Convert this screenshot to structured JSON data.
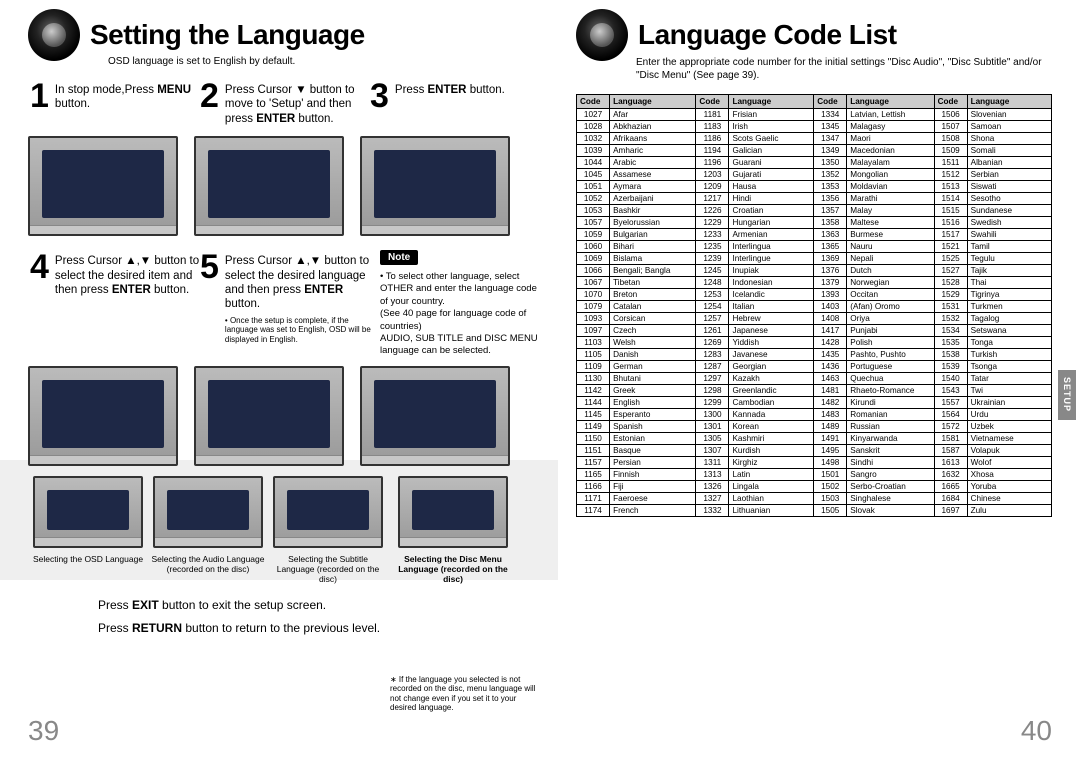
{
  "left": {
    "title": "Setting the Language",
    "subtitle": "OSD language is set to English by default.",
    "steps": [
      {
        "num": "1",
        "html": "In stop mode,Press <b>MENU</b> button."
      },
      {
        "num": "2",
        "html": "Press Cursor ▼ button to move to 'Setup' and then press <b>ENTER</b> button."
      },
      {
        "num": "3",
        "html": "Press <b>ENTER</b> button."
      },
      {
        "num": "4",
        "html": "Press Cursor ▲,▼ button to select the desired item and then press <b>ENTER</b> button."
      },
      {
        "num": "5",
        "html": "Press Cursor ▲,▼ button to select the desired language and then press <b>ENTER</b> button."
      }
    ],
    "step5_footnote": "• Once the setup is complete, if the language was set to English, OSD will be displayed in English.",
    "note_badge": "Note",
    "note_text": "• To select other language, select OTHER and enter the language code of your country.\n(See 40 page for language code of countries)\nAUDIO, SUB TITLE and DISC MENU language can be selected.",
    "captions": [
      "Selecting the OSD Language",
      "Selecting the Audio Language (recorded on the disc)",
      "Selecting the Subtitle Language (recorded on the disc)",
      "Selecting the Disc Menu Language (recorded on the disc)"
    ],
    "exit": "Press EXIT button to exit the setup screen.",
    "return": "Press RETURN button to return to the previous level.",
    "right_small_note": "∗ If the language you selected is not recorded on the disc, menu language will not change even if you set it to your desired language.",
    "page_no": "39"
  },
  "right": {
    "title": "Language Code List",
    "intro": "Enter the appropriate code number for the initial settings \"Disc Audio\", \"Disc Subtitle\" and/or \"Disc Menu\" (See page 39).",
    "headers": [
      "Code",
      "Language",
      "Code",
      "Language",
      "Code",
      "Language",
      "Code",
      "Language"
    ],
    "rows": [
      [
        "1027",
        "Afar",
        "1181",
        "Frisian",
        "1334",
        "Latvian, Lettish",
        "1506",
        "Slovenian"
      ],
      [
        "1028",
        "Abkhazian",
        "1183",
        "Irish",
        "1345",
        "Malagasy",
        "1507",
        "Samoan"
      ],
      [
        "1032",
        "Afrikaans",
        "1186",
        "Scots Gaelic",
        "1347",
        "Maori",
        "1508",
        "Shona"
      ],
      [
        "1039",
        "Amharic",
        "1194",
        "Galician",
        "1349",
        "Macedonian",
        "1509",
        "Somali"
      ],
      [
        "1044",
        "Arabic",
        "1196",
        "Guarani",
        "1350",
        "Malayalam",
        "1511",
        "Albanian"
      ],
      [
        "1045",
        "Assamese",
        "1203",
        "Gujarati",
        "1352",
        "Mongolian",
        "1512",
        "Serbian"
      ],
      [
        "1051",
        "Aymara",
        "1209",
        "Hausa",
        "1353",
        "Moldavian",
        "1513",
        "Siswati"
      ],
      [
        "1052",
        "Azerbaijani",
        "1217",
        "Hindi",
        "1356",
        "Marathi",
        "1514",
        "Sesotho"
      ],
      [
        "1053",
        "Bashkir",
        "1226",
        "Croatian",
        "1357",
        "Malay",
        "1515",
        "Sundanese"
      ],
      [
        "1057",
        "Byelorussian",
        "1229",
        "Hungarian",
        "1358",
        "Maltese",
        "1516",
        "Swedish"
      ],
      [
        "1059",
        "Bulgarian",
        "1233",
        "Armenian",
        "1363",
        "Burmese",
        "1517",
        "Swahili"
      ],
      [
        "1060",
        "Bihari",
        "1235",
        "Interlingua",
        "1365",
        "Nauru",
        "1521",
        "Tamil"
      ],
      [
        "1069",
        "Bislama",
        "1239",
        "Interlingue",
        "1369",
        "Nepali",
        "1525",
        "Tegulu"
      ],
      [
        "1066",
        "Bengali; Bangla",
        "1245",
        "Inupiak",
        "1376",
        "Dutch",
        "1527",
        "Tajik"
      ],
      [
        "1067",
        "Tibetan",
        "1248",
        "Indonesian",
        "1379",
        "Norwegian",
        "1528",
        "Thai"
      ],
      [
        "1070",
        "Breton",
        "1253",
        "Icelandic",
        "1393",
        "Occitan",
        "1529",
        "Tigrinya"
      ],
      [
        "1079",
        "Catalan",
        "1254",
        "Italian",
        "1403",
        "(Afan) Oromo",
        "1531",
        "Turkmen"
      ],
      [
        "1093",
        "Corsican",
        "1257",
        "Hebrew",
        "1408",
        "Oriya",
        "1532",
        "Tagalog"
      ],
      [
        "1097",
        "Czech",
        "1261",
        "Japanese",
        "1417",
        "Punjabi",
        "1534",
        "Setswana"
      ],
      [
        "1103",
        "Welsh",
        "1269",
        "Yiddish",
        "1428",
        "Polish",
        "1535",
        "Tonga"
      ],
      [
        "1105",
        "Danish",
        "1283",
        "Javanese",
        "1435",
        "Pashto, Pushto",
        "1538",
        "Turkish"
      ],
      [
        "1109",
        "German",
        "1287",
        "Georgian",
        "1436",
        "Portuguese",
        "1539",
        "Tsonga"
      ],
      [
        "1130",
        "Bhutani",
        "1297",
        "Kazakh",
        "1463",
        "Quechua",
        "1540",
        "Tatar"
      ],
      [
        "1142",
        "Greek",
        "1298",
        "Greenlandic",
        "1481",
        "Rhaeto-Romance",
        "1543",
        "Twi"
      ],
      [
        "1144",
        "English",
        "1299",
        "Cambodian",
        "1482",
        "Kirundi",
        "1557",
        "Ukrainian"
      ],
      [
        "1145",
        "Esperanto",
        "1300",
        "Kannada",
        "1483",
        "Romanian",
        "1564",
        "Urdu"
      ],
      [
        "1149",
        "Spanish",
        "1301",
        "Korean",
        "1489",
        "Russian",
        "1572",
        "Uzbek"
      ],
      [
        "1150",
        "Estonian",
        "1305",
        "Kashmiri",
        "1491",
        "Kinyarwanda",
        "1581",
        "Vietnamese"
      ],
      [
        "1151",
        "Basque",
        "1307",
        "Kurdish",
        "1495",
        "Sanskrit",
        "1587",
        "Volapuk"
      ],
      [
        "1157",
        "Persian",
        "1311",
        "Kirghiz",
        "1498",
        "Sindhi",
        "1613",
        "Wolof"
      ],
      [
        "1165",
        "Finnish",
        "1313",
        "Latin",
        "1501",
        "Sangro",
        "1632",
        "Xhosa"
      ],
      [
        "1166",
        "Fiji",
        "1326",
        "Lingala",
        "1502",
        "Serbo-Croatian",
        "1665",
        "Yoruba"
      ],
      [
        "1171",
        "Faeroese",
        "1327",
        "Laothian",
        "1503",
        "Singhalese",
        "1684",
        "Chinese"
      ],
      [
        "1174",
        "French",
        "1332",
        "Lithuanian",
        "1505",
        "Slovak",
        "1697",
        "Zulu"
      ]
    ],
    "side_tab": "SETUP",
    "page_no": "40"
  }
}
